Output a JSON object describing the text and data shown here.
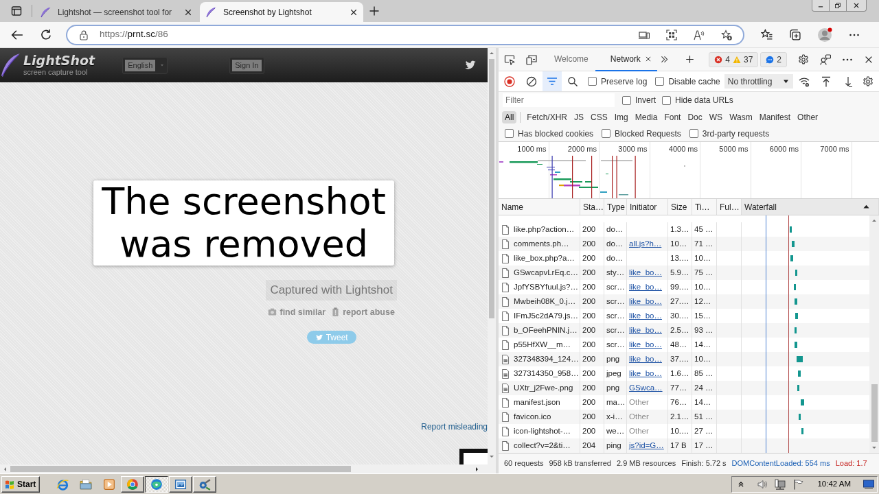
{
  "browser": {
    "tabs": [
      {
        "title": "Lightshot — screenshot tool for",
        "selected": false
      },
      {
        "title": "Screenshot by Lightshot",
        "selected": true
      }
    ],
    "address": {
      "scheme": "https://",
      "host": "prnt.sc",
      "path": "/86"
    }
  },
  "page": {
    "logo": {
      "title": "LightShot",
      "subtitle": "screen capture tool"
    },
    "language": "English",
    "sign_in": "Sign In",
    "message": "The screenshot was removed",
    "captured": "Captured with Lightshot",
    "actions": [
      "find similar",
      "report abuse"
    ],
    "tweet": "Tweet",
    "report_link": "Report misleading"
  },
  "devtools": {
    "tabs": [
      {
        "label": "Welcome",
        "selected": false
      },
      {
        "label": "Network",
        "selected": true
      }
    ],
    "issues": {
      "errors": "4",
      "warnings": "37",
      "messages": "2"
    },
    "recording": true,
    "filter_toggle_on": true,
    "options": [
      {
        "label": "Preserve log",
        "checked": false
      },
      {
        "label": "Disable cache",
        "checked": false
      }
    ],
    "throttling": "No throttling",
    "filter": {
      "placeholder": "Filter"
    },
    "filter_options": [
      {
        "label": "Invert",
        "checked": false
      },
      {
        "label": "Hide data URLs",
        "checked": false
      }
    ],
    "type_filters": [
      {
        "label": "All",
        "selected": true
      },
      {
        "label": "Fetch/XHR",
        "selected": false
      },
      {
        "label": "JS",
        "selected": false
      },
      {
        "label": "CSS",
        "selected": false
      },
      {
        "label": "Img",
        "selected": false
      },
      {
        "label": "Media",
        "selected": false
      },
      {
        "label": "Font",
        "selected": false
      },
      {
        "label": "Doc",
        "selected": false
      },
      {
        "label": "WS",
        "selected": false
      },
      {
        "label": "Wasm",
        "selected": false
      },
      {
        "label": "Manifest",
        "selected": false
      },
      {
        "label": "Other",
        "selected": false
      }
    ],
    "request_filters": [
      {
        "label": "Has blocked cookies",
        "checked": false
      },
      {
        "label": "Blocked Requests",
        "checked": false
      },
      {
        "label": "3rd-party requests",
        "checked": false
      }
    ],
    "overview": {
      "ticks": [
        "1000 ms",
        "2000 ms",
        "3000 ms",
        "4000 ms",
        "5000 ms",
        "6000 ms",
        "7000 ms"
      ]
    },
    "table": {
      "columns": [
        {
          "label": "Name",
          "sorted": false
        },
        {
          "label": "Sta…",
          "sorted": false
        },
        {
          "label": "Type",
          "sorted": false
        },
        {
          "label": "Initiator",
          "sorted": false
        },
        {
          "label": "Size",
          "sorted": false
        },
        {
          "label": "Ti…",
          "sorted": false
        },
        {
          "label": "Ful…",
          "sorted": false
        },
        {
          "label": "Waterfall",
          "sorted": true
        }
      ],
      "rows": [
        {
          "kind": "document",
          "name": "like.php?action…",
          "status": "200",
          "type": "do…",
          "size": "1.3…",
          "time": "45 …"
        },
        {
          "kind": "document",
          "name": "comments.ph…",
          "status": "200",
          "type": "do…",
          "initiator": {
            "text": "all.js?h…",
            "link": true
          },
          "size": "10…",
          "time": "71 …"
        },
        {
          "kind": "document",
          "name": "like_box.php?a…",
          "status": "200",
          "type": "do…",
          "size": "13.…",
          "time": "10…"
        },
        {
          "kind": "document",
          "name": "GSwcapvLrEq.c…",
          "status": "200",
          "type": "sty…",
          "initiator": {
            "text": "like_bo…",
            "link": true
          },
          "size": "5.9…",
          "time": "75 …"
        },
        {
          "kind": "document",
          "name": "JpfYSBYfuul.js?…",
          "status": "200",
          "type": "scr…",
          "initiator": {
            "text": "like_bo…",
            "link": true
          },
          "size": "99.…",
          "time": "10…"
        },
        {
          "kind": "document",
          "name": "Mwbeih08K_0.j…",
          "status": "200",
          "type": "scr…",
          "initiator": {
            "text": "like_bo…",
            "link": true
          },
          "size": "27.…",
          "time": "12…"
        },
        {
          "kind": "document",
          "name": "IFmJ5c2dA79.js…",
          "status": "200",
          "type": "scr…",
          "initiator": {
            "text": "like_bo…",
            "link": true
          },
          "size": "30.…",
          "time": "15…"
        },
        {
          "kind": "document",
          "name": "b_OFeehPNIN.j…",
          "status": "200",
          "type": "scr…",
          "initiator": {
            "text": "like_bo…",
            "link": true
          },
          "size": "2.5…",
          "time": "93 …"
        },
        {
          "kind": "document",
          "name": "p55HfXW__m…",
          "status": "200",
          "type": "scr…",
          "initiator": {
            "text": "like_bo…",
            "link": true
          },
          "size": "48…",
          "time": "14…"
        },
        {
          "kind": "image",
          "name": "327348394_124…",
          "status": "200",
          "type": "png",
          "initiator": {
            "text": "like_bo…",
            "link": true
          },
          "size": "37.…",
          "time": "10…"
        },
        {
          "kind": "image",
          "name": "327314350_958…",
          "status": "200",
          "type": "jpeg",
          "initiator": {
            "text": "like_bo…",
            "link": true
          },
          "size": "1.6…",
          "time": "85 …"
        },
        {
          "kind": "image",
          "name": "UXtr_j2Fwe-.png",
          "status": "200",
          "type": "png",
          "initiator": {
            "text": "GSwca…",
            "link": true
          },
          "size": "77…",
          "time": "24 …"
        },
        {
          "kind": "document",
          "name": "manifest.json",
          "status": "200",
          "type": "ma…",
          "initiator": {
            "text": "Other",
            "link": false
          },
          "size": "76…",
          "time": "14…"
        },
        {
          "kind": "document",
          "name": "favicon.ico",
          "status": "200",
          "type": "x-i…",
          "initiator": {
            "text": "Other",
            "link": false
          },
          "size": "2.1…",
          "time": "51 …"
        },
        {
          "kind": "document",
          "name": "icon-lightshot-…",
          "status": "200",
          "type": "we…",
          "initiator": {
            "text": "Other",
            "link": false
          },
          "size": "10.…",
          "time": "27 …"
        },
        {
          "kind": "document",
          "name": "collect?v=2&ti…",
          "status": "204",
          "type": "ping",
          "initiator": {
            "text": "js?id=G…",
            "link": true
          },
          "size": "17 B",
          "time": "17 …"
        }
      ]
    },
    "status_bar": [
      {
        "text": "60 requests",
        "kind": "plain"
      },
      {
        "text": "958 kB transferred",
        "kind": "plain"
      },
      {
        "text": "2.9 MB resources",
        "kind": "plain"
      },
      {
        "text": "Finish: 5.72 s",
        "kind": "plain"
      },
      {
        "text": "DOMContentLoaded: 554 ms",
        "kind": "dom"
      },
      {
        "text": "Load: 1.7",
        "kind": "load"
      }
    ]
  },
  "taskbar": {
    "start": "Start",
    "windows": [
      {
        "selected": false
      },
      {
        "selected": true
      },
      {
        "selected": false
      },
      {
        "selected": false
      }
    ],
    "clock": "10:42 AM"
  }
}
